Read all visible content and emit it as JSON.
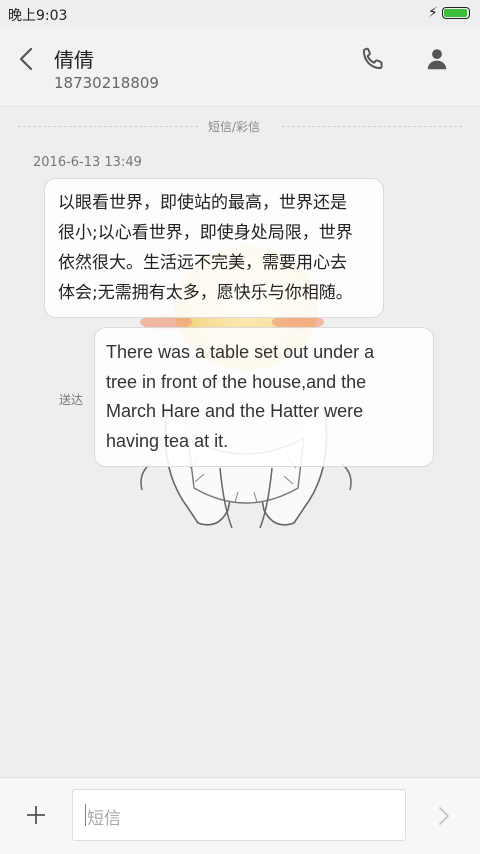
{
  "status_bar": {
    "time": "晚上9:03",
    "battery_level": 1.0,
    "charging": true
  },
  "header": {
    "contact_name": "倩倩",
    "contact_number": "18730218809",
    "icons": [
      "back-arrow-icon",
      "phone-icon",
      "person-icon"
    ]
  },
  "thread": {
    "divider_label": "短信/彩信",
    "timestamp": "2016-6-13 13:49",
    "messages": [
      {
        "direction": "incoming",
        "lines": [
          "以眼看世界，即使站的最高，世界还是",
          "很小;以心看世界，即使身处局限，世界",
          "依然很大。生活远不完美，需要用心去",
          "体会;无需拥有太多，愿快乐与你相随。"
        ]
      },
      {
        "direction": "outgoing",
        "status": "送达",
        "lines": [
          "There was a table set out under a",
          "tree in front of the house,and the",
          "March Hare and the Hatter were",
          "having tea at it."
        ]
      }
    ]
  },
  "composer": {
    "placeholder": "短信",
    "icons": [
      "plus-icon",
      "send-arrow-icon"
    ]
  },
  "colors": {
    "background": "#eeeeee",
    "battery": "#3bbf3b",
    "caret": "#3a8ee6"
  }
}
